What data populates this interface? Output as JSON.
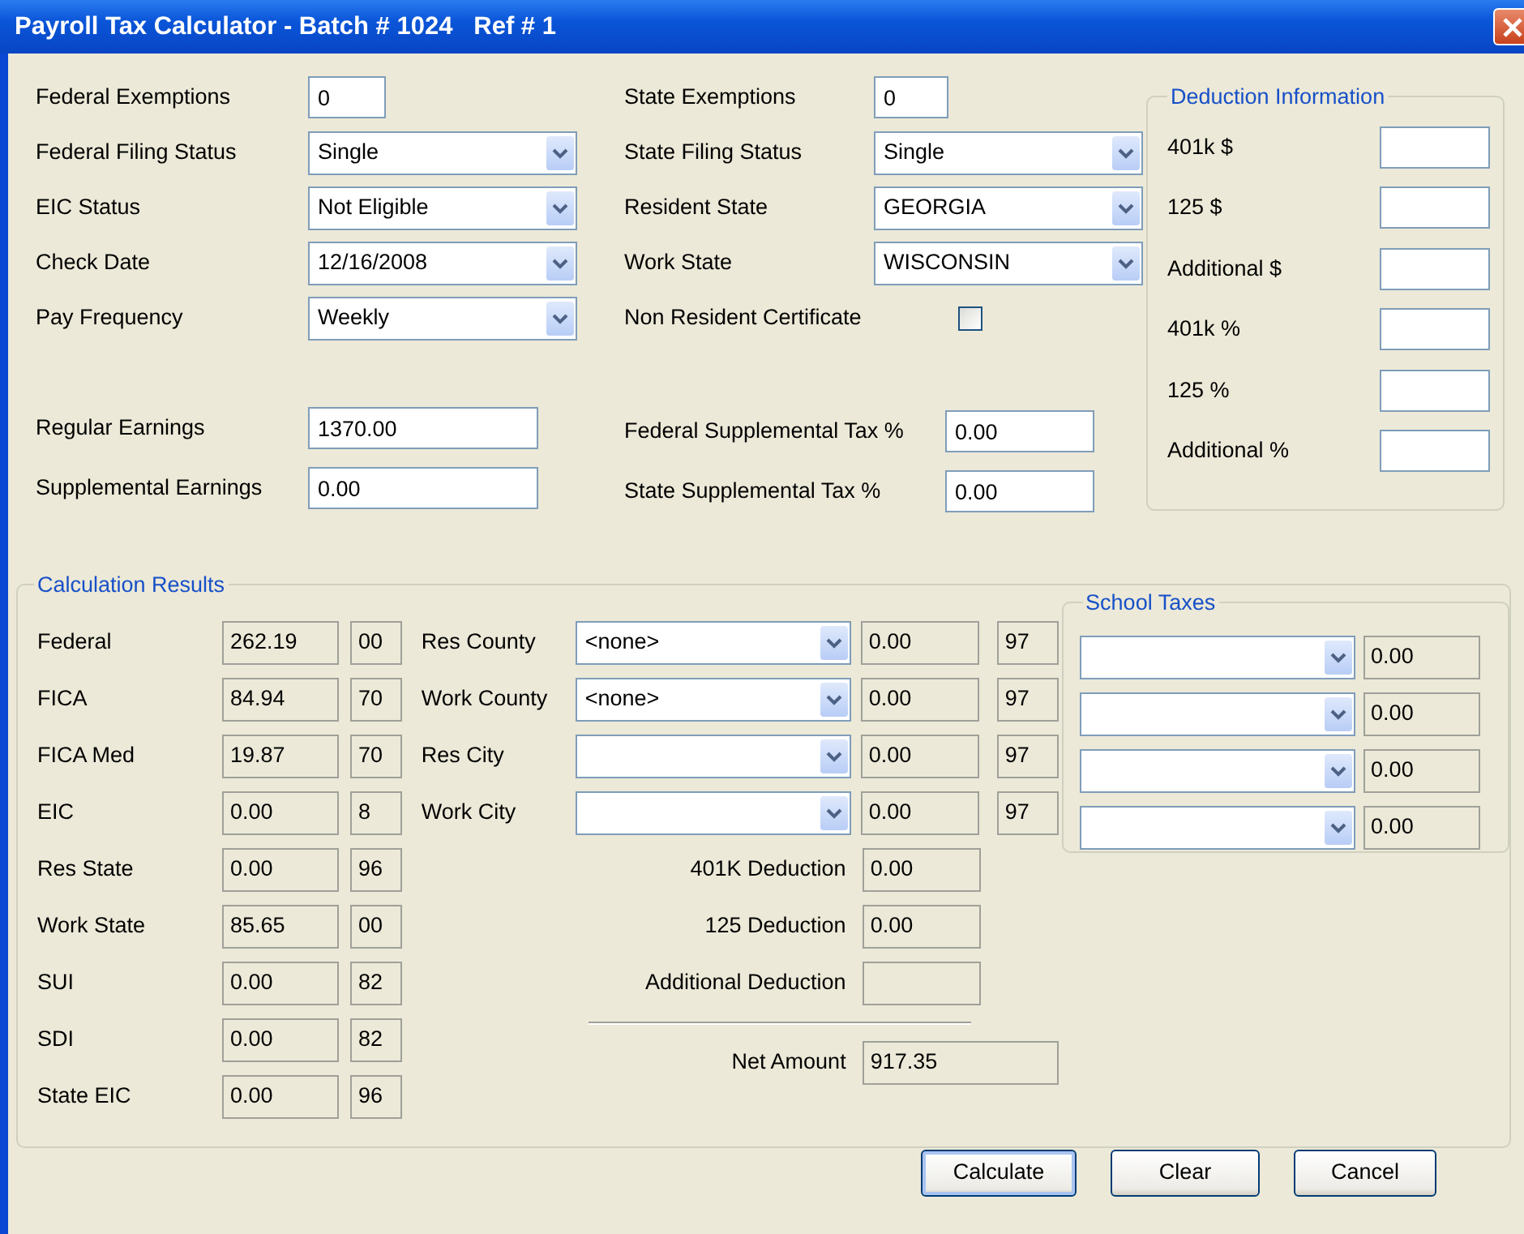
{
  "window": {
    "title": "Payroll Tax Calculator - Batch # 1024   Ref # 1"
  },
  "employee_fields": [
    {
      "kind": "text",
      "label": "Federal Exemptions",
      "value": "0"
    },
    {
      "kind": "select",
      "label": "Federal Filing Status",
      "value": "Single"
    },
    {
      "kind": "select",
      "label": "EIC Status",
      "value": "Not Eligible"
    },
    {
      "kind": "select",
      "label": "Check Date",
      "value": "12/16/2008"
    },
    {
      "kind": "select",
      "label": "Pay Frequency",
      "value": "Weekly"
    },
    {
      "kind": "text",
      "label": "Regular Earnings",
      "value": "1370.00"
    },
    {
      "kind": "text",
      "label": "Supplemental Earnings",
      "value": "0.00"
    }
  ],
  "state_fields": [
    {
      "kind": "text",
      "label": "State Exemptions",
      "value": "0"
    },
    {
      "kind": "select",
      "label": "State Filing Status",
      "value": "Single"
    },
    {
      "kind": "select",
      "label": "Resident State",
      "value": "GEORGIA"
    },
    {
      "kind": "select",
      "label": "Work State",
      "value": "WISCONSIN"
    },
    {
      "kind": "checkbox",
      "label": "Non Resident Certificate",
      "checked": false
    },
    {
      "kind": "text",
      "label": "Federal Supplemental Tax %",
      "value": "0.00"
    },
    {
      "kind": "text",
      "label": "State Supplemental Tax %",
      "value": "0.00"
    }
  ],
  "deduction_information": {
    "title": "Deduction Information",
    "fields": [
      {
        "label": "401k $"
      },
      {
        "label": "125 $"
      },
      {
        "label": "Additional $"
      },
      {
        "label": "401k %"
      },
      {
        "label": "125 %"
      },
      {
        "label": "Additional %"
      }
    ]
  },
  "calculation_results": {
    "title": "Calculation Results",
    "taxes": [
      {
        "label": "Federal",
        "amount": "262.19",
        "code": "00"
      },
      {
        "label": "FICA",
        "amount": "84.94",
        "code": "70"
      },
      {
        "label": "FICA Med",
        "amount": "19.87",
        "code": "70"
      },
      {
        "label": "EIC",
        "amount": "0.00",
        "code": "8"
      },
      {
        "label": "Res State",
        "amount": "0.00",
        "code": "96"
      },
      {
        "label": "Work State",
        "amount": "85.65",
        "code": "00"
      },
      {
        "label": "SUI",
        "amount": "0.00",
        "code": "82"
      },
      {
        "label": "SDI",
        "amount": "0.00",
        "code": "82"
      },
      {
        "label": "State EIC",
        "amount": "0.00",
        "code": "96"
      }
    ],
    "localities": [
      {
        "label": "Res County",
        "selection": "<none>",
        "amount": "0.00",
        "code": "97"
      },
      {
        "label": "Work County",
        "selection": "<none>",
        "amount": "0.00",
        "code": "97"
      },
      {
        "label": "Res City",
        "amount": "0.00",
        "code": "97"
      },
      {
        "label": "Work City",
        "amount": "0.00",
        "code": "97"
      }
    ],
    "deductions": [
      {
        "label": "401K Deduction",
        "amount": "0.00"
      },
      {
        "label": "125 Deduction",
        "amount": "0.00"
      },
      {
        "label": "Additional Deduction"
      }
    ],
    "net_amount": {
      "label": "Net Amount",
      "amount": "917.35"
    },
    "school_taxes": {
      "title": "School Taxes",
      "rows": [
        {
          "amount": "0.00"
        },
        {
          "amount": "0.00"
        },
        {
          "amount": "0.00"
        },
        {
          "amount": "0.00"
        }
      ]
    }
  },
  "buttons": [
    {
      "label": "Calculate",
      "default": true
    },
    {
      "label": "Clear",
      "default": false
    },
    {
      "label": "Cancel",
      "default": false
    }
  ]
}
